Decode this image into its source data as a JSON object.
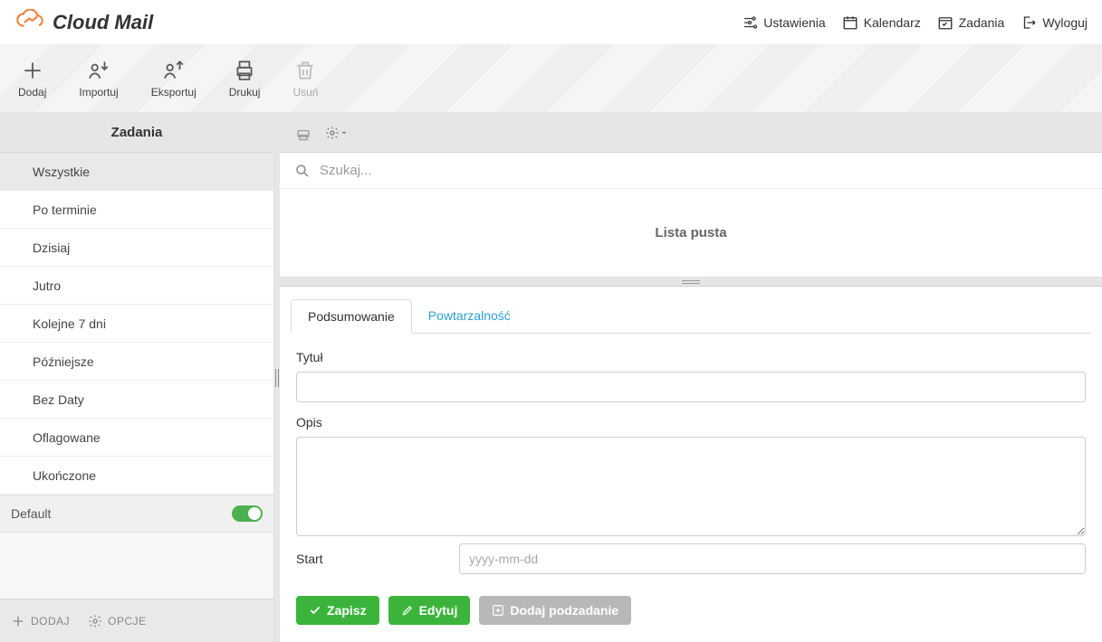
{
  "app": {
    "brand": "Cloud Mail"
  },
  "header_nav": {
    "settings": "Ustawienia",
    "calendar": "Kalendarz",
    "tasks": "Zadania",
    "logout": "Wyloguj"
  },
  "toolbar": {
    "add": "Dodaj",
    "import": "Importuj",
    "export": "Eksportuj",
    "print": "Drukuj",
    "delete": "Usuń"
  },
  "sidebar": {
    "title": "Zadania",
    "filters": [
      "Wszystkie",
      "Po terminie",
      "Dzisiaj",
      "Jutro",
      "Kolejne 7 dni",
      "Późniejsze",
      "Bez Daty",
      "Oflagowane",
      "Ukończone"
    ],
    "calendar_row": {
      "name": "Default",
      "enabled": true
    },
    "footer": {
      "add": "DODAJ",
      "options": "OPCJE"
    }
  },
  "content": {
    "search_placeholder": "Szukaj...",
    "empty_list": "Lista pusta",
    "tabs": {
      "summary": "Podsumowanie",
      "recurrence": "Powtarzalność"
    },
    "form": {
      "title_label": "Tytuł",
      "desc_label": "Opis",
      "start_label": "Start",
      "start_placeholder": "yyyy-mm-dd"
    },
    "actions": {
      "save": "Zapisz",
      "edit": "Edytuj",
      "add_subtask": "Dodaj podzadanie"
    }
  }
}
